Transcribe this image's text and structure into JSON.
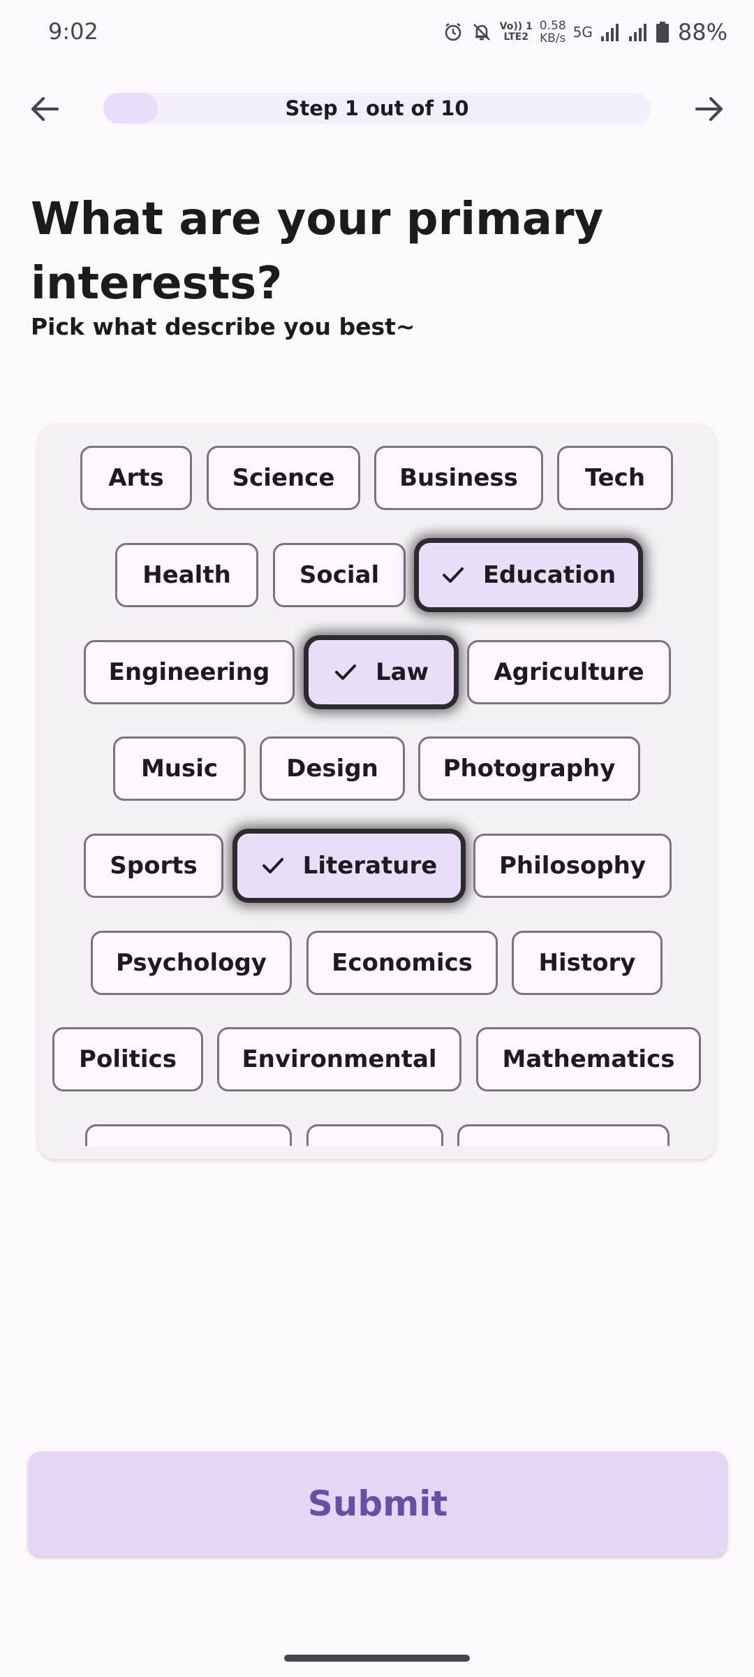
{
  "status_bar": {
    "time": "9:02",
    "volte_top": "Vo)) 1",
    "volte_bottom": "LTE2",
    "speed_value": "0.58",
    "speed_unit": "KB/s",
    "network": "5G",
    "battery": "88%"
  },
  "nav": {
    "back_icon": "arrow-left-icon",
    "forward_icon": "arrow-right-icon",
    "progress_label": "Step 1 out of 10",
    "progress_fraction": 0.1
  },
  "header": {
    "title": "What are your primary interests?",
    "subtitle": "Pick what describe you best~"
  },
  "chips": [
    {
      "label": "Arts",
      "selected": false
    },
    {
      "label": "Science",
      "selected": false
    },
    {
      "label": "Business",
      "selected": false
    },
    {
      "label": "Tech",
      "selected": false
    },
    {
      "label": "Health",
      "selected": false
    },
    {
      "label": "Social",
      "selected": false
    },
    {
      "label": "Education",
      "selected": true
    },
    {
      "label": "Engineering",
      "selected": false
    },
    {
      "label": "Law",
      "selected": true
    },
    {
      "label": "Agriculture",
      "selected": false
    },
    {
      "label": "Music",
      "selected": false
    },
    {
      "label": "Design",
      "selected": false
    },
    {
      "label": "Photography",
      "selected": false
    },
    {
      "label": "Sports",
      "selected": false
    },
    {
      "label": "Literature",
      "selected": true
    },
    {
      "label": "Philosophy",
      "selected": false
    },
    {
      "label": "Psychology",
      "selected": false
    },
    {
      "label": "Economics",
      "selected": false
    },
    {
      "label": "History",
      "selected": false
    },
    {
      "label": "Politics",
      "selected": false
    },
    {
      "label": "Environmental",
      "selected": false
    },
    {
      "label": "Mathematics",
      "selected": false
    },
    {
      "label": "",
      "selected": false
    },
    {
      "label": "",
      "selected": false
    },
    {
      "label": "",
      "selected": false
    }
  ],
  "actions": {
    "submit_label": "Submit"
  },
  "colors": {
    "background": "#fdf8fd",
    "card": "#f4f0f6",
    "chip_selected": "#e8def8",
    "submit_bg": "#e4d7f5",
    "submit_text": "#6750a4",
    "outline": "#79747e"
  }
}
